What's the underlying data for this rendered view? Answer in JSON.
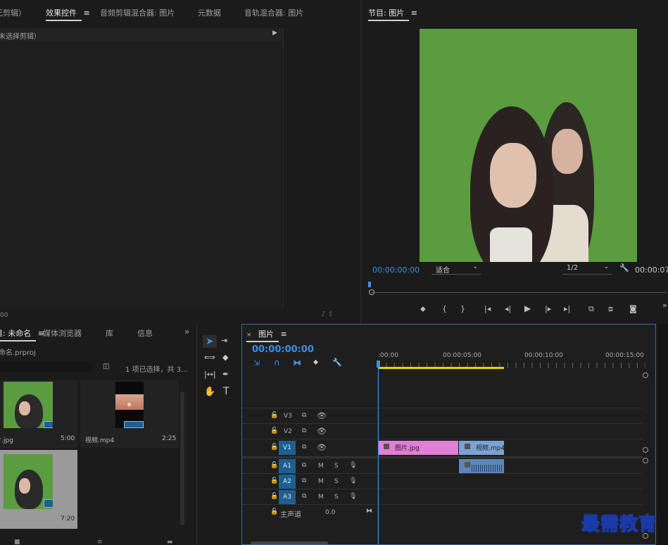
{
  "source_panel": {
    "tabs": [
      "（无剪辑）",
      "效果控件",
      "音频剪辑混合器: 图片",
      "元数据",
      "音轨混合器: 图片"
    ],
    "active_tab": "效果控件",
    "content_header": "（未选择剪辑）",
    "bottom_time": "00"
  },
  "program_monitor": {
    "title": "节目: 图片",
    "current_time": "00:00:00:00",
    "fit_label": "适合",
    "resolution": "1/2",
    "end_time": "00:00:07:",
    "bg_color": "#5a9c3f"
  },
  "project_panel": {
    "tabs": [
      "项目: 未命名",
      "媒体浏览器",
      "库",
      "信息"
    ],
    "project_file": "未命名.prproj",
    "selection_info": "1 项已选择，共 3...",
    "items": [
      {
        "name": "图片.jpg",
        "duration": "5:00"
      },
      {
        "name": "视频.mp4",
        "duration": "2:25"
      },
      {
        "name": "",
        "duration": "7:20"
      }
    ]
  },
  "timeline": {
    "sequence_title": "图片",
    "timecode": "00:00:00:00",
    "ruler": [
      ":00:00",
      "00:00:05:00",
      "00:00:10:00",
      "00:00:15:00"
    ],
    "video_tracks": [
      "V3",
      "V2",
      "V1"
    ],
    "audio_tracks": [
      "A1",
      "A2",
      "A3"
    ],
    "master_label": "主声道",
    "master_value": "0.0",
    "mute": "M",
    "solo": "S",
    "clips": {
      "image_clip": "图片.jpg",
      "video_clip": "视频.mp4 [V]"
    }
  },
  "watermark": "最需教育"
}
